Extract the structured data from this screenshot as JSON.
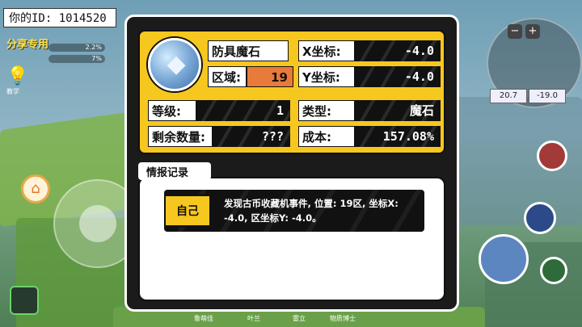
{
  "player": {
    "id_label": "你的ID: 1014520",
    "share_label": "分享专用"
  },
  "hud": {
    "stat_1": "2.2%",
    "stat_2": "7%",
    "teach_label": "教学",
    "minimap_coords": [
      "20.7",
      "-19.0"
    ]
  },
  "item": {
    "name": "防具魔石",
    "region_label": "区域:",
    "region_value": "19",
    "x_label": "X坐标:",
    "x_value": "-4.0",
    "y_label": "Y坐标:",
    "y_value": "-4.0",
    "level_label": "等级:",
    "level_value": "1",
    "type_label": "类型:",
    "type_value": "魔石",
    "remaining_label": "剩余数量:",
    "remaining_value": "???",
    "cost_label": "成本:",
    "cost_value": "157.08%"
  },
  "log": {
    "header": "情报记录",
    "entries": [
      {
        "tag": "自己",
        "text": "发现古币收藏机事件, 位置: 19区, 坐标X: -4.0, 区坐标Y: -4.0。"
      }
    ]
  },
  "bottom_menu": [
    "鲁萌佳",
    "叶兰",
    "雷立",
    "物质博士"
  ],
  "colors": {
    "accent_yellow": "#f6c71e",
    "region_orange": "#e87a3a",
    "panel_dark": "#1b1b1b"
  }
}
